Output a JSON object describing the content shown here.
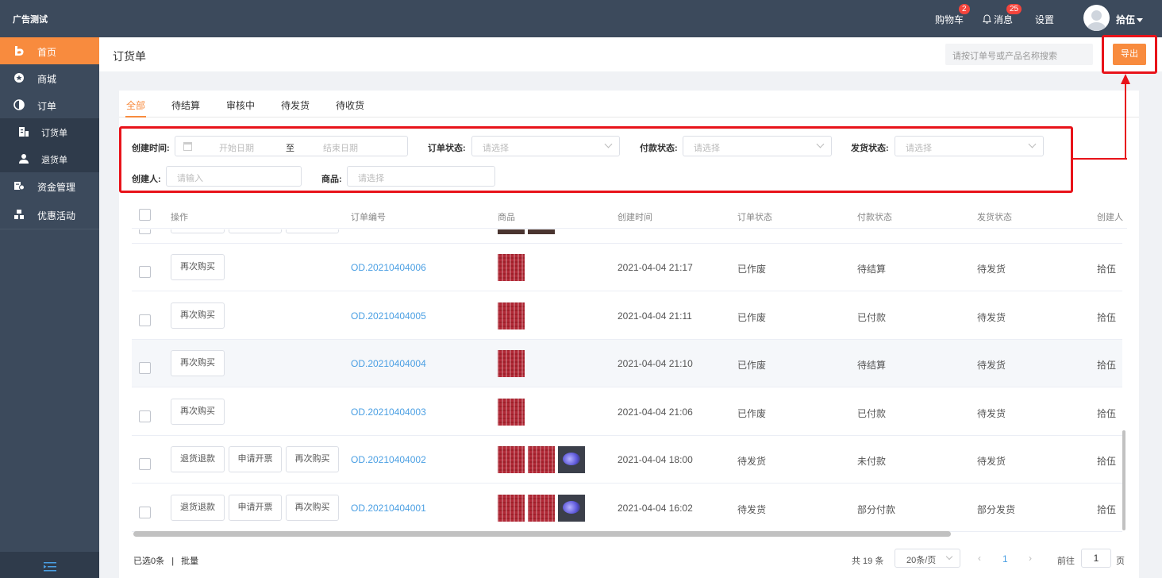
{
  "header": {
    "brand": "广告测试",
    "cart_label": "购物车",
    "cart_count": "2",
    "messages_label": "消息",
    "messages_count": "25",
    "settings_label": "设置",
    "username": "拾伍"
  },
  "sidebar": {
    "items": [
      {
        "label": "首页",
        "icon": "home-icon"
      },
      {
        "label": "商城",
        "icon": "mall-icon"
      },
      {
        "label": "订单",
        "icon": "order-icon"
      },
      {
        "label": "订货单",
        "icon": "order-form-icon"
      },
      {
        "label": "退货单",
        "icon": "return-form-icon"
      },
      {
        "label": "资金管理",
        "icon": "funds-icon"
      },
      {
        "label": "优惠活动",
        "icon": "promotion-icon"
      }
    ]
  },
  "page": {
    "title": "订货单",
    "search_placeholder": "请按订单号或产品名称搜索",
    "export_label": "导出"
  },
  "tabs": [
    "全部",
    "待结算",
    "审核中",
    "待发货",
    "待收货"
  ],
  "filters": {
    "created_time_label": "创建时间:",
    "start_placeholder": "开始日期",
    "date_separator": "至",
    "end_placeholder": "结束日期",
    "order_status_label": "订单状态:",
    "order_status_placeholder": "请选择",
    "pay_status_label": "付款状态:",
    "pay_status_placeholder": "请选择",
    "ship_status_label": "发货状态:",
    "ship_status_placeholder": "请选择",
    "creator_label": "创建人:",
    "creator_placeholder": "请输入",
    "product_label": "商品:",
    "product_placeholder": "请选择"
  },
  "table": {
    "columns": [
      "操作",
      "订单编号",
      "商品",
      "创建时间",
      "订单状态",
      "付款状态",
      "发货状态",
      "创建人"
    ],
    "rows": [
      {
        "actions": [
          "再次购买"
        ],
        "order_no": "OD.20210404006",
        "thumbs": [
          "kb"
        ],
        "created": "2021-04-04 21:17",
        "order_status": "已作废",
        "pay_status": "待结算",
        "ship_status": "待发货",
        "creator": "拾伍"
      },
      {
        "actions": [
          "再次购买"
        ],
        "order_no": "OD.20210404005",
        "thumbs": [
          "kb"
        ],
        "created": "2021-04-04 21:11",
        "order_status": "已作废",
        "pay_status": "已付款",
        "ship_status": "待发货",
        "creator": "拾伍"
      },
      {
        "actions": [
          "再次购买"
        ],
        "order_no": "OD.20210404004",
        "thumbs": [
          "kb"
        ],
        "created": "2021-04-04 21:10",
        "order_status": "已作废",
        "pay_status": "待结算",
        "ship_status": "待发货",
        "creator": "拾伍"
      },
      {
        "actions": [
          "再次购买"
        ],
        "order_no": "OD.20210404003",
        "thumbs": [
          "kb"
        ],
        "created": "2021-04-04 21:06",
        "order_status": "已作废",
        "pay_status": "已付款",
        "ship_status": "待发货",
        "creator": "拾伍"
      },
      {
        "actions": [
          "退货退款",
          "申请开票",
          "再次购买"
        ],
        "order_no": "OD.20210404002",
        "thumbs": [
          "kb",
          "kb",
          "mouse"
        ],
        "created": "2021-04-04 18:00",
        "order_status": "待发货",
        "pay_status": "未付款",
        "ship_status": "待发货",
        "creator": "拾伍"
      },
      {
        "actions": [
          "退货退款",
          "申请开票",
          "再次购买"
        ],
        "order_no": "OD.20210404001",
        "thumbs": [
          "kb",
          "kb",
          "mouse"
        ],
        "created": "2021-04-04 16:02",
        "order_status": "待发货",
        "pay_status": "部分付款",
        "ship_status": "部分发货",
        "creator": "拾伍"
      }
    ]
  },
  "footer": {
    "selected": "已选0条",
    "divider": "|",
    "batch": "批量",
    "total": "共 19 条",
    "page_size": "20条/页",
    "current_page": "1",
    "goto_label": "前往",
    "goto_value": "1",
    "goto_unit": "页"
  },
  "colors": {
    "accent": "#f88b3e",
    "sidebar": "#3c4a5c",
    "link": "#4a9fe3",
    "annotation": "#e8131a"
  }
}
